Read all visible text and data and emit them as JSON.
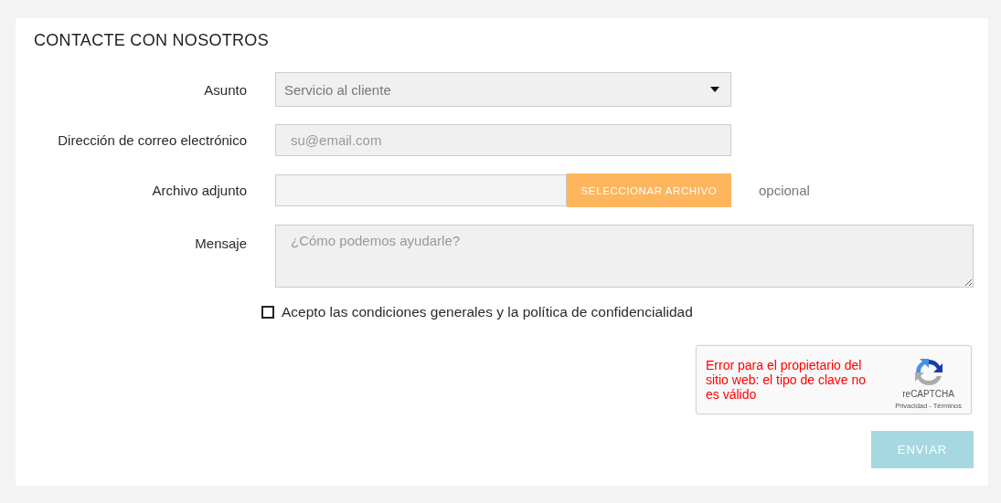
{
  "title": "CONTACTE CON NOSOTROS",
  "subject": {
    "label": "Asunto",
    "value": "Servicio al cliente"
  },
  "email": {
    "label": "Dirección de correo electrónico",
    "placeholder": "su@email.com"
  },
  "attachment": {
    "label": "Archivo adjunto",
    "button": "SELECCIONAR ARCHIVO",
    "note": "opcional"
  },
  "message": {
    "label": "Mensaje",
    "placeholder": "¿Cómo podemos ayudarle?"
  },
  "terms": {
    "label": "Acepto las condiciones generales y la política de confidencialidad",
    "checked": false
  },
  "captcha": {
    "error": "Error para el propietario del sitio web: el tipo de clave no es válido",
    "brand": "reCAPTCHA",
    "links": "Privacidad - Términos"
  },
  "submit": {
    "label": "ENVIAR",
    "disabled": true
  }
}
